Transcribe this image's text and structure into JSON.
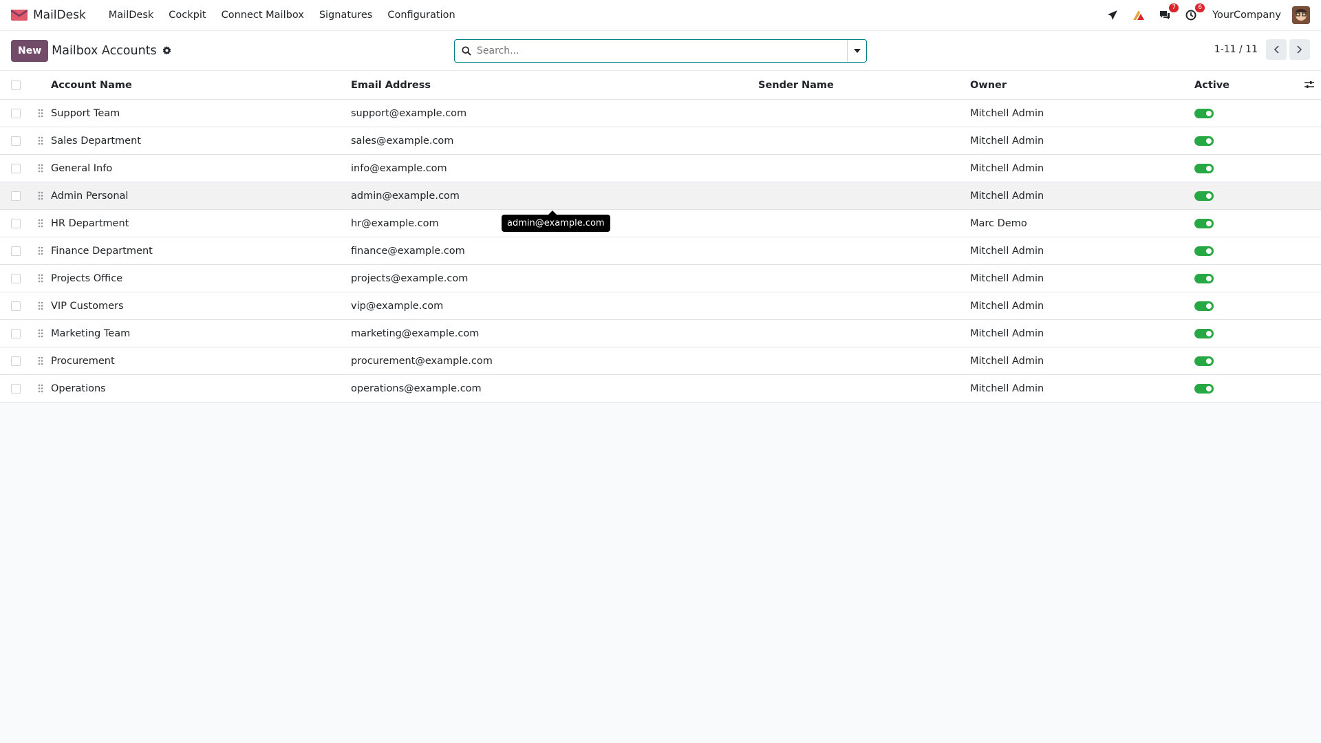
{
  "navbar": {
    "brand_name": "MailDesk",
    "menu": [
      "MailDesk",
      "Cockpit",
      "Connect Mailbox",
      "Signatures",
      "Configuration"
    ],
    "messages_count": "7",
    "activities_count": "6",
    "company": "YourCompany"
  },
  "control": {
    "new_label": "New",
    "title": "Mailbox Accounts",
    "search_placeholder": "Search...",
    "pager": "1-11 / 11"
  },
  "table": {
    "columns": [
      "Account Name",
      "Email Address",
      "Sender Name",
      "Owner",
      "Active"
    ],
    "rows": [
      {
        "name": "Support Team",
        "email": "support@example.com",
        "sender": "",
        "owner": "Mitchell Admin",
        "active": true
      },
      {
        "name": "Sales Department",
        "email": "sales@example.com",
        "sender": "",
        "owner": "Mitchell Admin",
        "active": true
      },
      {
        "name": "General Info",
        "email": "info@example.com",
        "sender": "",
        "owner": "Mitchell Admin",
        "active": true
      },
      {
        "name": "Admin Personal",
        "email": "admin@example.com",
        "sender": "",
        "owner": "Mitchell Admin",
        "active": true
      },
      {
        "name": "HR Department",
        "email": "hr@example.com",
        "sender": "",
        "owner": "Marc Demo",
        "active": true
      },
      {
        "name": "Finance Department",
        "email": "finance@example.com",
        "sender": "",
        "owner": "Mitchell Admin",
        "active": true
      },
      {
        "name": "Projects Office",
        "email": "projects@example.com",
        "sender": "",
        "owner": "Mitchell Admin",
        "active": true
      },
      {
        "name": "VIP Customers",
        "email": "vip@example.com",
        "sender": "",
        "owner": "Mitchell Admin",
        "active": true
      },
      {
        "name": "Marketing Team",
        "email": "marketing@example.com",
        "sender": "",
        "owner": "Mitchell Admin",
        "active": true
      },
      {
        "name": "Procurement",
        "email": "procurement@example.com",
        "sender": "",
        "owner": "Mitchell Admin",
        "active": true
      },
      {
        "name": "Operations",
        "email": "operations@example.com",
        "sender": "",
        "owner": "Mitchell Admin",
        "active": true
      }
    ]
  },
  "tooltip": {
    "text": "admin@example.com"
  },
  "colors": {
    "brand": "#714b67",
    "toggle_on": "#28a745",
    "search_border": "#017e84"
  }
}
